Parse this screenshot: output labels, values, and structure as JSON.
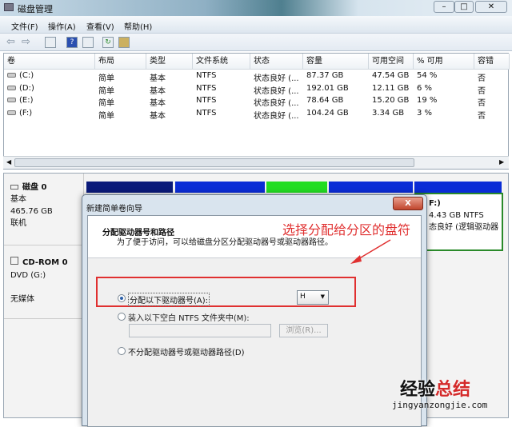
{
  "window": {
    "title": "磁盘管理"
  },
  "menu": [
    "文件(F)",
    "操作(A)",
    "查看(V)",
    "帮助(H)"
  ],
  "table": {
    "columns": [
      "卷",
      "布局",
      "类型",
      "文件系统",
      "状态",
      "容量",
      "可用空间",
      "% 可用",
      "容错"
    ],
    "rows": [
      [
        "(C:)",
        "简单",
        "基本",
        "NTFS",
        "状态良好 (...",
        "87.37 GB",
        "47.54 GB",
        "54 %",
        "否"
      ],
      [
        "(D:)",
        "简单",
        "基本",
        "NTFS",
        "状态良好 (...",
        "192.01 GB",
        "12.11 GB",
        "6 %",
        "否"
      ],
      [
        "(E:)",
        "简单",
        "基本",
        "NTFS",
        "状态良好 (...",
        "78.64 GB",
        "15.20 GB",
        "19 %",
        "否"
      ],
      [
        "(F:)",
        "简单",
        "基本",
        "NTFS",
        "状态良好 (...",
        "104.24 GB",
        "3.34 GB",
        "3 %",
        "否"
      ]
    ]
  },
  "disks": [
    {
      "name": "磁盘 0",
      "type": "基本",
      "size": "465.76 GB",
      "status": "联机"
    },
    {
      "name": "CD-ROM 0",
      "type": "DVD (G:)",
      "status": "无媒体"
    }
  ],
  "partition_f": {
    "label": "F:)",
    "size": "4.43 GB NTFS",
    "status": "态良好 (逻辑驱动器"
  },
  "dialog": {
    "title": "新建简单卷向导",
    "close": "X",
    "heading": "分配驱动器号和路径",
    "subheading": "为了便于访问，可以给磁盘分区分配驱动器号或驱动器路径。",
    "option1": "分配以下驱动器号(A):",
    "drive_letter": "H",
    "option2": "装入以下空白 NTFS 文件夹中(M):",
    "browse": "浏览(R)...",
    "option3": "不分配驱动器号或驱动器路径(D)"
  },
  "annotation": "选择分配给分区的盘符",
  "watermark": {
    "cn1": "经验",
    "cn2": "总结",
    "url": "jingyanzongjie.com"
  },
  "colors": {
    "annotation": "#e03030",
    "primary_part": "#0a1a7a",
    "logical": "#0a2cd6",
    "free": "#22dd22"
  }
}
